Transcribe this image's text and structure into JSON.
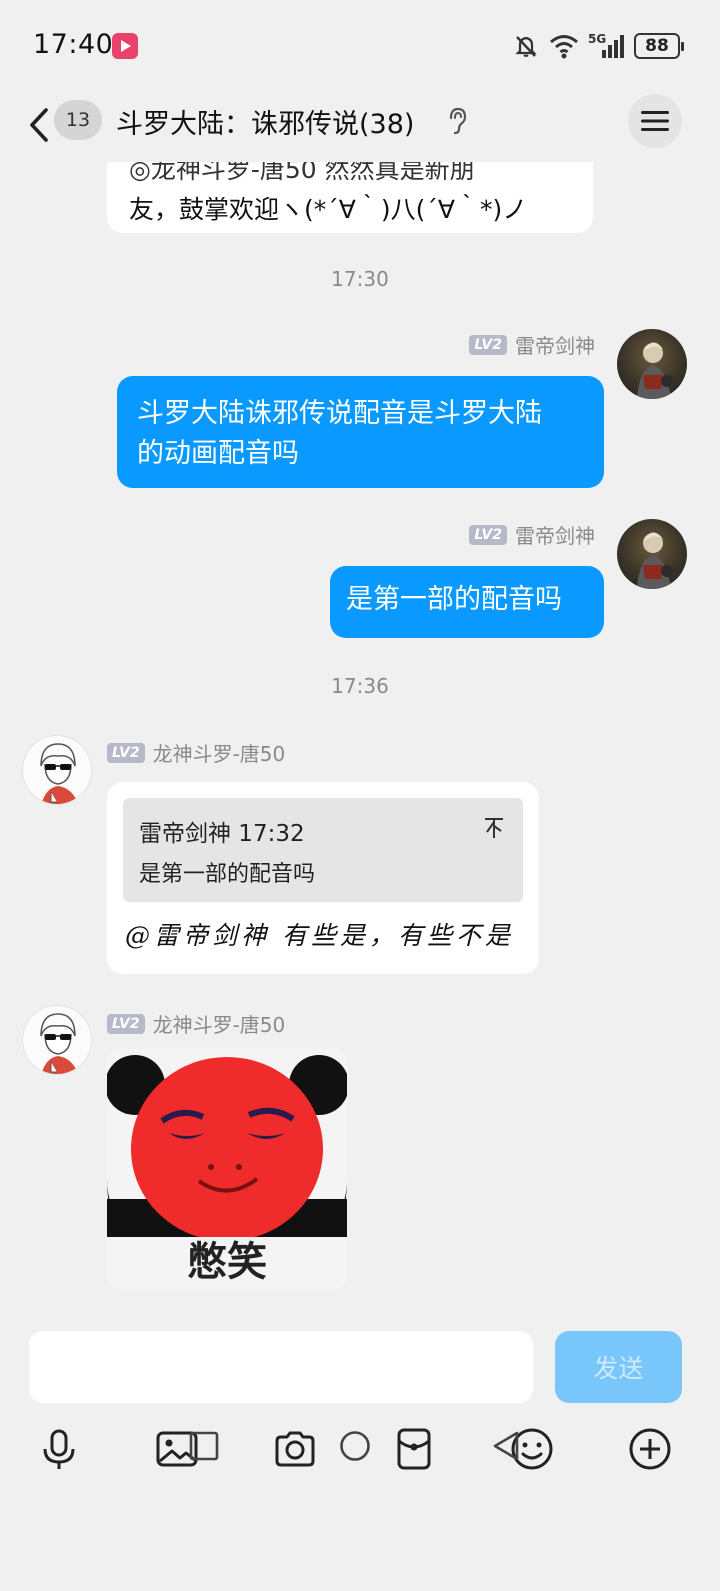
{
  "status_bar": {
    "time": "17:40",
    "network": "5G",
    "battery": "88"
  },
  "header": {
    "unread_count": "13",
    "title": "斗罗大陆：诛邪传说(38)"
  },
  "messages": {
    "partial_line1": "◎龙神斗罗-唐50 然然真是新朋",
    "partial_line2": "友，鼓掌欢迎ヽ(*´∀｀)八(´∀｀*)ノ",
    "timestamp1": "17:30",
    "msg1": {
      "level": "LV2",
      "sender": "雷帝剑神",
      "text_line1": "斗罗大陆诛邪传说配音是斗罗大陆",
      "text_line2": "的动画配音吗"
    },
    "msg2": {
      "level": "LV2",
      "sender": "雷帝剑神",
      "text": "是第一部的配音吗"
    },
    "timestamp2": "17:36",
    "msg3": {
      "level": "LV2",
      "sender": "龙神斗罗-唐50",
      "quote_meta": "雷帝剑神 17:32",
      "quote_text": "是第一部的配音吗",
      "reply": "@雷帝剑神 有些是，有些不是"
    },
    "msg4": {
      "level": "LV2",
      "sender": "龙神斗罗-唐50",
      "sticker_caption": "憋笑"
    }
  },
  "input": {
    "send_label": "发送"
  },
  "colors": {
    "accent_blue": "#0a99ff",
    "background": "#f0f0f0"
  }
}
